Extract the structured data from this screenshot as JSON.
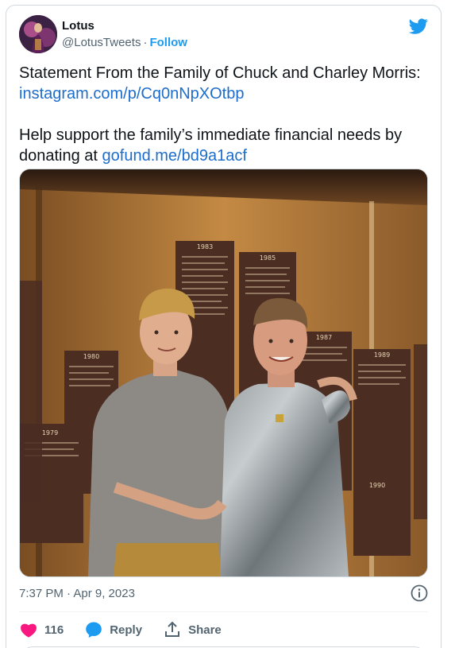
{
  "author": {
    "name": "Lotus",
    "handle": "@LotusTweets",
    "separator": "·",
    "follow_label": "Follow"
  },
  "tweet": {
    "line1": "Statement From the Family of Chuck and Charley Morris:",
    "link1": "instagram.com/p/Cq0nNpXOtbp",
    "line2_prefix": "Help support the family’s immediate financial needs by donating at ",
    "link2": "gofund.me/bd9a1acf"
  },
  "media": {
    "wall_plaques": [
      {
        "year": "1983"
      },
      {
        "year": "1985"
      },
      {
        "year": "1980"
      },
      {
        "year": "1987"
      },
      {
        "year": "1989"
      },
      {
        "year": "1979"
      },
      {
        "year": "1990"
      }
    ]
  },
  "meta": {
    "timestamp": "7:37 PM · Apr 9, 2023"
  },
  "actions": {
    "like_count": "116",
    "reply_label": "Reply",
    "share_label": "Share"
  },
  "colors": {
    "accent": "#1d9bf0",
    "like": "#f91880",
    "link": "#1d6dcc",
    "muted": "#536471"
  }
}
